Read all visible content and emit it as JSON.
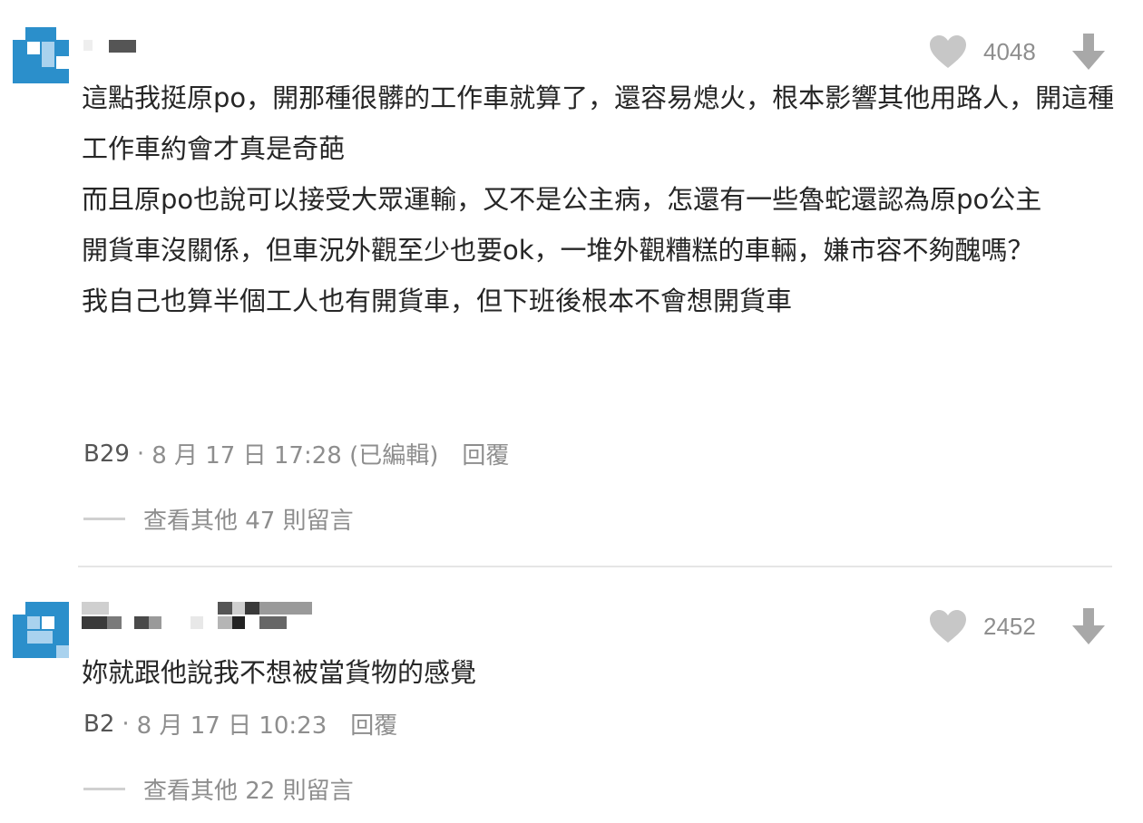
{
  "comments": [
    {
      "likes": "4048",
      "body": "這點我挺原po，開那種很髒的工作車就算了，還容易熄火，根本影響其他用路人，開這種工作車約會才真是奇葩\n而且原po也說可以接受大眾運輸，又不是公主病，怎還有一些魯蛇還認為原po公主\n開貨車沒關係，但車況外觀至少也要ok，一堆外觀糟糕的車輛，嫌市容不夠醜嗎？\n我自己也算半個工人也有開貨車，但下班後根本不會想開貨車",
      "floor": "B29",
      "date": "8 月 17 日 17:28 (已編輯)",
      "reply_label": "回覆",
      "more_label": "查看其他 47 則留言"
    },
    {
      "likes": "2452",
      "body": "妳就跟他說我不想被當貨物的感覺",
      "floor": "B2",
      "date": "8 月 17 日 10:23",
      "reply_label": "回覆",
      "more_label": "查看其他 22 則留言"
    }
  ],
  "icons": {
    "like": "heart-icon",
    "dislike": "arrow-down-icon"
  },
  "colors": {
    "avatar_blue": "#2b8fcb",
    "avatar_light": "#a9d2ee",
    "muted": "#8e8e8e",
    "heart": "#c7c7c7"
  }
}
